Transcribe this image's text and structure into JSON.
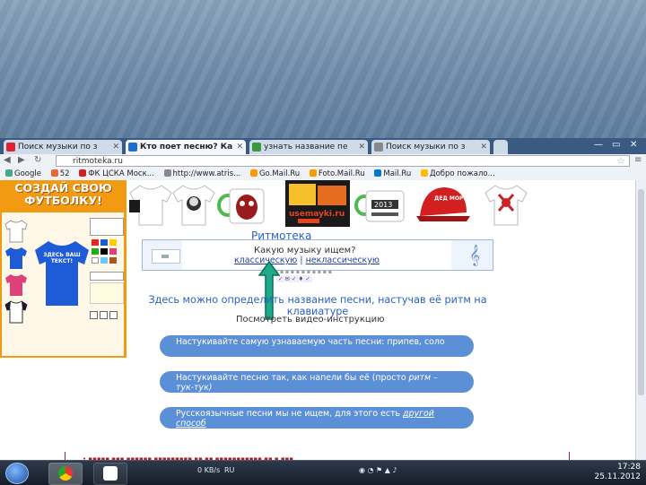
{
  "browser": {
    "tabs": [
      {
        "label": "Поиск музыки по з",
        "active": false
      },
      {
        "label": "Кто поет песню? Ка",
        "active": true
      },
      {
        "label": "узнать название пе",
        "active": false
      },
      {
        "label": "Поиск музыки по з",
        "active": false
      }
    ],
    "url": "ritmoteka.ru",
    "bookmarks": [
      "Google",
      "52",
      "ФК ЦСКА Моск...",
      "http://www.atris...",
      "Go.Mail.Ru",
      "Foto.Mail.Ru",
      "Mail.Ru",
      "Добро пожало..."
    ]
  },
  "ad": {
    "title_line1": "СОЗДАЙ СВОЮ",
    "title_line2": "ФУТБОЛКУ!",
    "shirt_text": "ЗДЕСЬ ВАШ ТЕКСТ!",
    "shirt_colors": [
      "#ffffff",
      "#1e5bd6",
      "#e0407a",
      "#1b1b2a"
    ]
  },
  "merch_labels": [
    "2013",
    "ДЕД МОРОЗ",
    "usemayki.ru"
  ],
  "ritmoteka": {
    "title": "Ритмотека",
    "question": "Какую музыку ищем?",
    "link_classic": "классическую",
    "separator": "|",
    "link_nonclassic": "неклассическую",
    "hint": "Здесь можно определить название песни, настучав её ритм на клавиатуре",
    "video_link": "Посмотреть видео-инструкцию",
    "pills": [
      {
        "text": "Настукивайте самую узнаваемую часть песни: припев, соло",
        "italic": ""
      },
      {
        "text": "Настукивайте песню так, как напели бы её (просто",
        "italic": "ритм – тук-тук)"
      },
      {
        "text": "Русскоязычные песни мы не ищем, для этого есть",
        "italic": "другой способ"
      }
    ]
  },
  "taskbar": {
    "tray_lang": "RU",
    "net_speed": "0 KB/s",
    "time": "17:28",
    "date": "25.11.2012"
  }
}
